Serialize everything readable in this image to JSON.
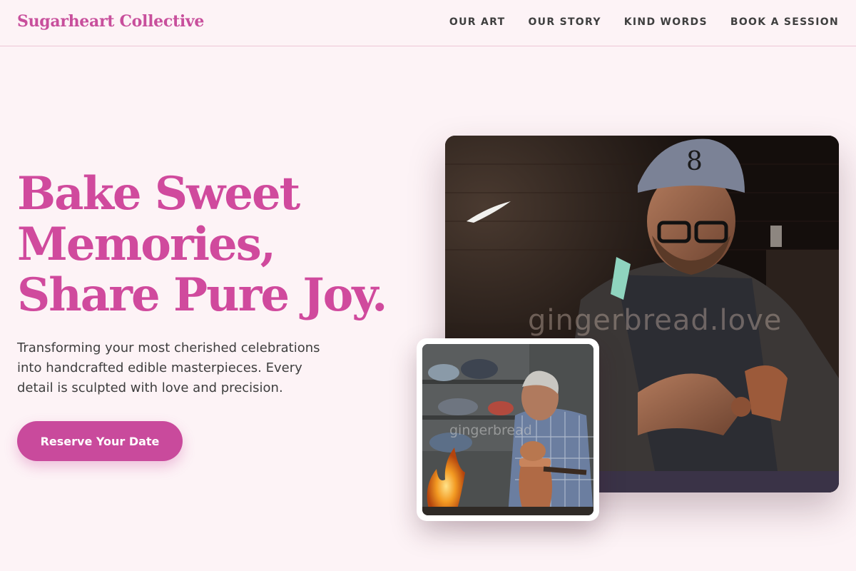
{
  "brand": {
    "name": "Sugarheart Collective"
  },
  "nav": {
    "items": [
      {
        "label": "OUR ART"
      },
      {
        "label": "OUR STORY"
      },
      {
        "label": "KIND WORDS"
      },
      {
        "label": "BOOK A SESSION"
      }
    ]
  },
  "hero": {
    "title_lines": [
      "Bake Sweet",
      "Memories,",
      "Share Pure Joy."
    ],
    "description": "Transforming your most cherished celebrations into handcrafted edible masterpieces. Every detail is sculpted with love and precision.",
    "cta_label": "Reserve Your Date"
  },
  "images": {
    "main_watermark": "gingerbread.love",
    "inset_watermark": "gingerbread"
  },
  "colors": {
    "background": "#fdf3f6",
    "brand_pink": "#c84f9c",
    "button_pink": "#c94a9c",
    "text_dark": "#3e3e3e"
  }
}
